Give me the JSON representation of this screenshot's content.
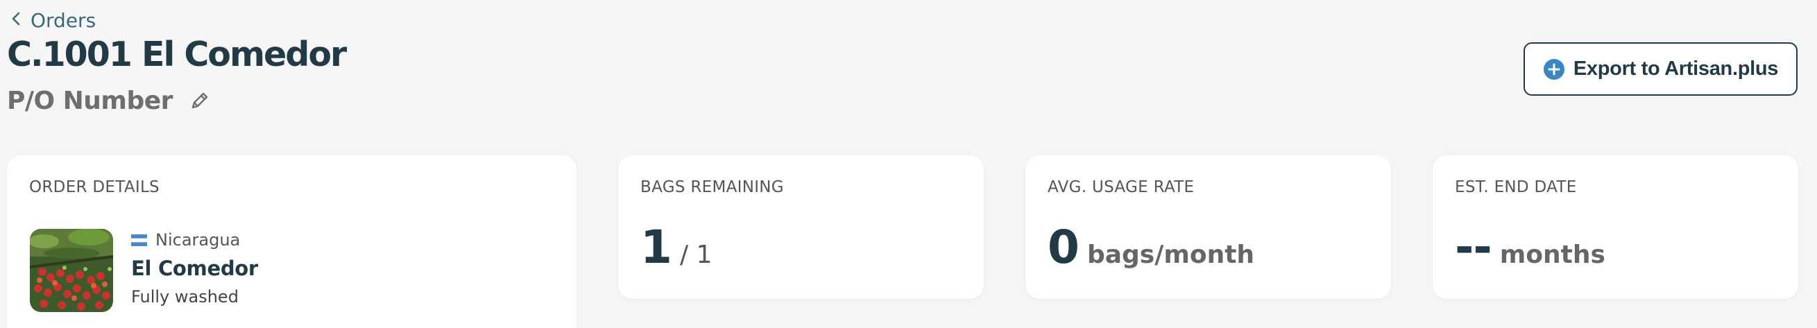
{
  "breadcrumb": {
    "label": "Orders"
  },
  "order": {
    "title": "C.1001 El Comedor",
    "po_label": "P/O Number"
  },
  "actions": {
    "export_label": "Export to Artisan.plus"
  },
  "colors": {
    "primary": "#223a45",
    "accent": "#3a86c4",
    "background": "#f5f5f5",
    "card": "#ffffff"
  },
  "icons": {
    "back": "chevron-left-icon",
    "edit": "pencil-icon",
    "export": "plus-circle-icon",
    "flag": "nicaragua-flag-icon"
  },
  "order_details": {
    "label": "ORDER DETAILS",
    "country": "Nicaragua",
    "coffee_name": "El Comedor",
    "process": "Fully washed"
  },
  "bags_remaining": {
    "label": "BAGS REMAINING",
    "value": "1",
    "total": "/ 1"
  },
  "usage_rate": {
    "label": "AVG. USAGE RATE",
    "value": "0",
    "unit": "bags/month"
  },
  "end_date": {
    "label": "EST. END DATE",
    "value": "--",
    "unit": "months"
  }
}
